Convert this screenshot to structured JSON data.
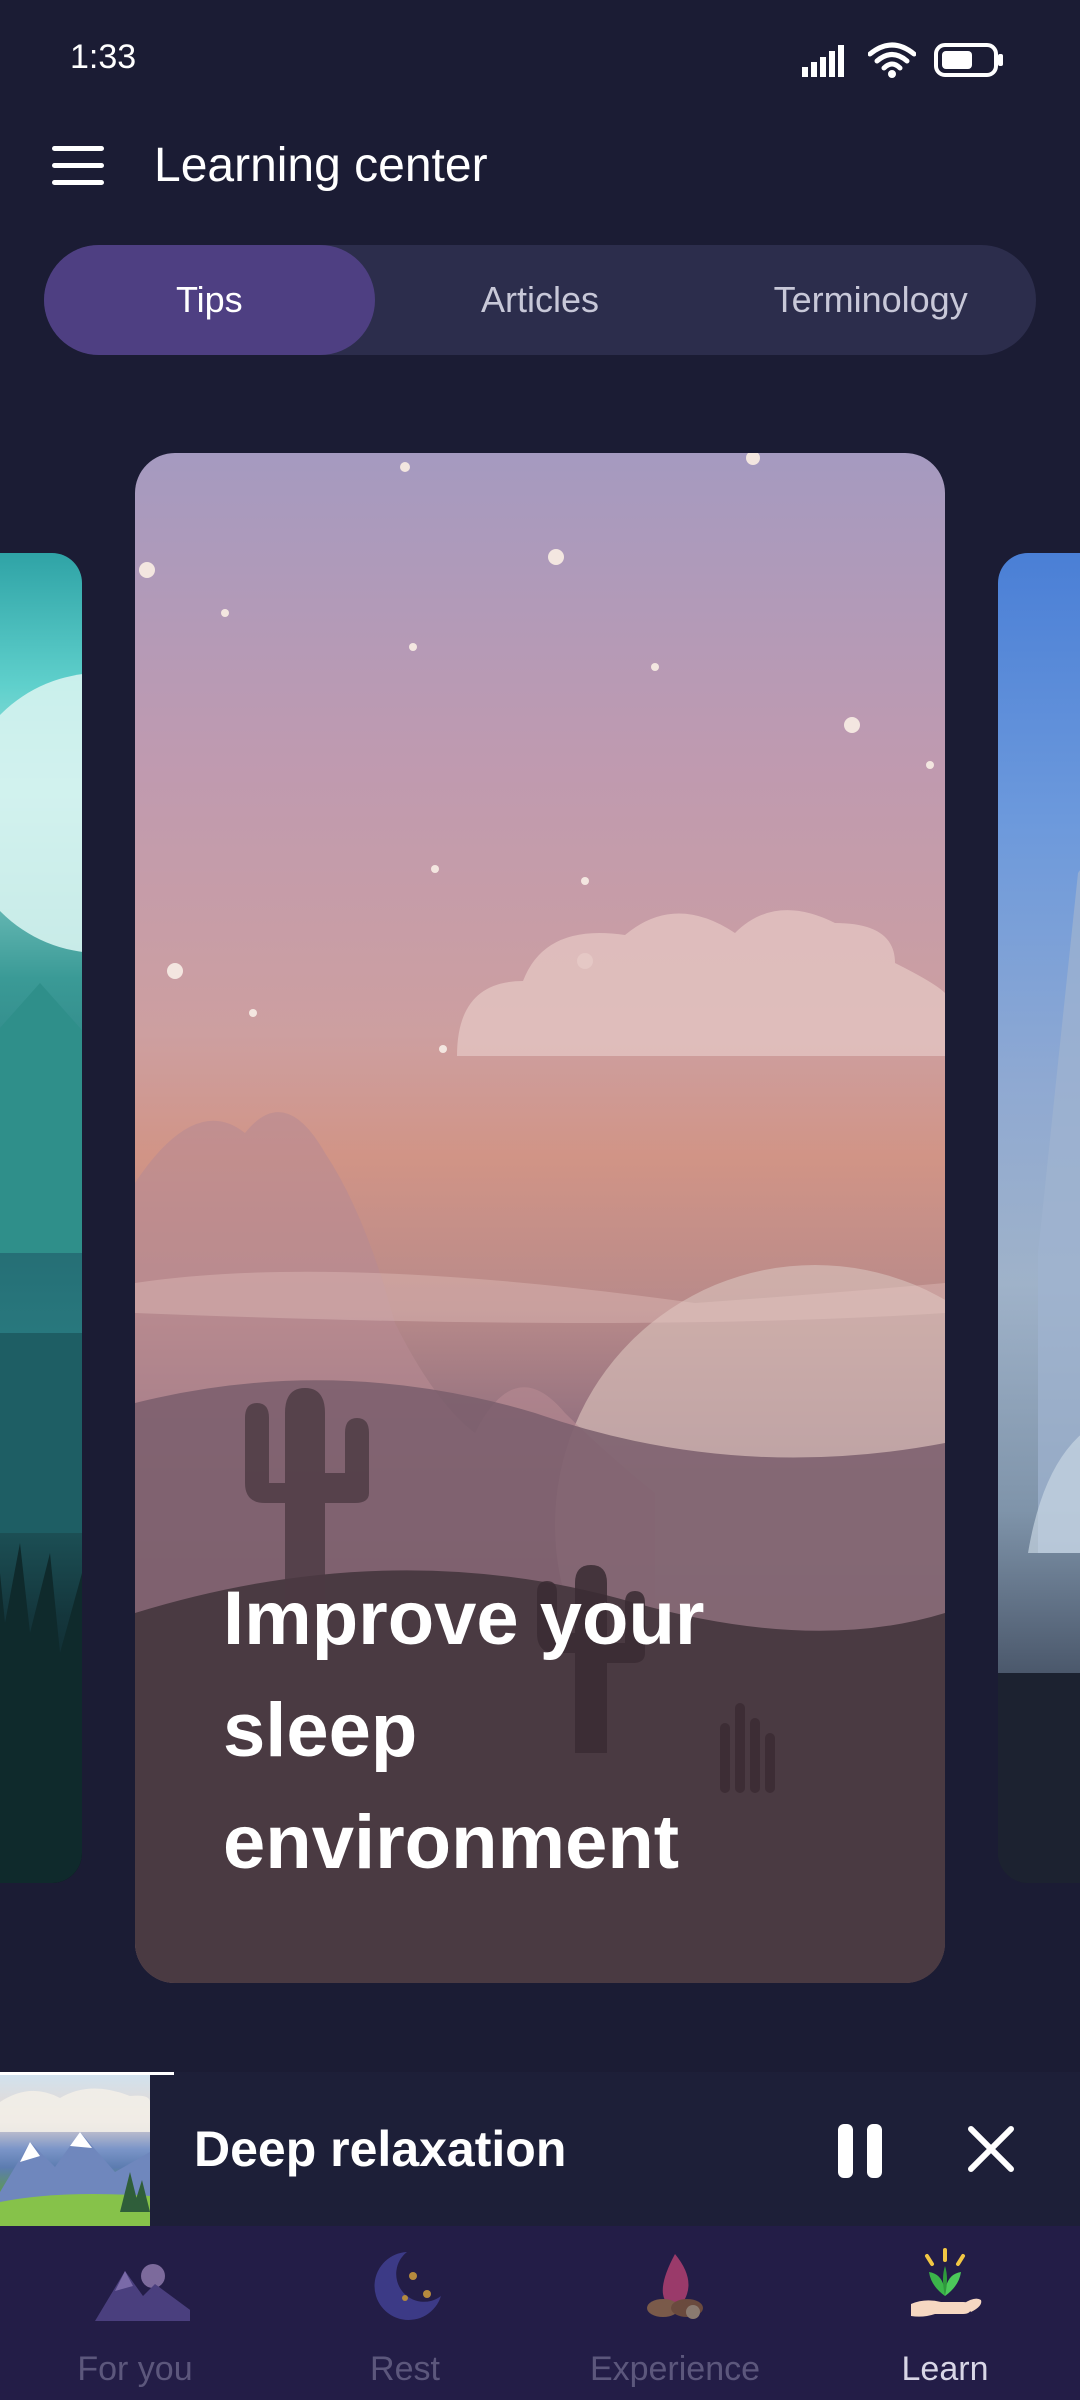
{
  "status_bar": {
    "time": "1:33",
    "icons": [
      "signal-icon",
      "wifi-icon",
      "battery-icon"
    ]
  },
  "header": {
    "title": "Learning center",
    "menu_icon": "hamburger-menu-icon"
  },
  "tabs": [
    {
      "label": "Tips",
      "active": true
    },
    {
      "label": "Articles",
      "active": false
    },
    {
      "label": "Terminology",
      "active": false
    }
  ],
  "carousel": {
    "current_card": {
      "title": "Improve your sleep environment"
    }
  },
  "mini_player": {
    "title": "Deep relaxation",
    "pause_icon": "pause-icon",
    "close_icon": "close-icon"
  },
  "bottom_nav": [
    {
      "label": "For you",
      "icon": "mountain-moon-icon",
      "active": false
    },
    {
      "label": "Rest",
      "icon": "crescent-moon-icon",
      "active": false
    },
    {
      "label": "Experience",
      "icon": "campfire-icon",
      "active": false
    },
    {
      "label": "Learn",
      "icon": "hand-plant-icon",
      "active": true
    }
  ],
  "colors": {
    "background": "#1b1c34",
    "tab_active": "#4e3f82",
    "tab_bar": "#2c2d4c",
    "nav_bar": "#231d47",
    "nav_inactive": "#5c577c"
  }
}
